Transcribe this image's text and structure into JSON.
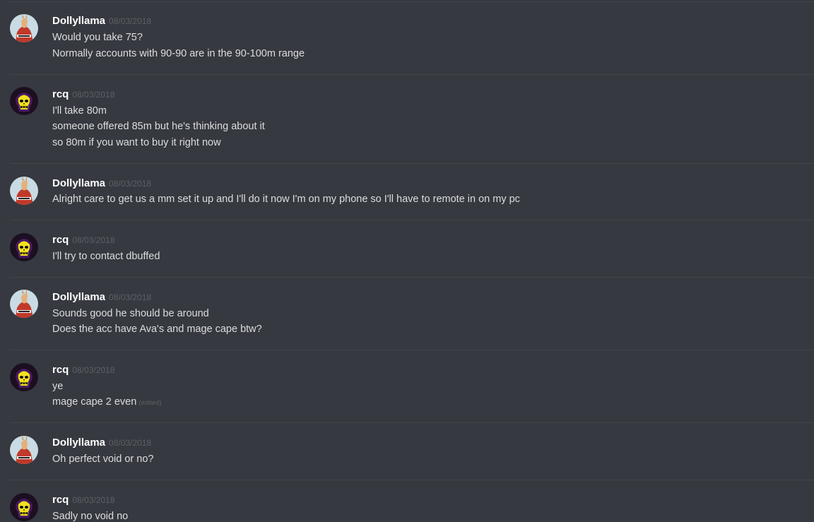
{
  "messages": [
    {
      "author": "Dollyllama",
      "timestamp": "08/03/2018",
      "avatar": "llama-avatar",
      "lines": [
        "Would you take 75?",
        "Normally accounts with 90-90 are in the 90-100m range"
      ]
    },
    {
      "author": "rcq",
      "timestamp": "08/03/2018",
      "avatar": "skull-avatar",
      "lines": [
        "I'll take 80m",
        "someone offered 85m but he's thinking about it",
        "so 80m if you want to buy it right now"
      ]
    },
    {
      "author": "Dollyllama",
      "timestamp": "08/03/2018",
      "avatar": "llama-avatar",
      "lines": [
        "Alright care to get us a mm set it up and I'll do it now I'm on my phone so I'll have to remote in on my pc"
      ]
    },
    {
      "author": "rcq",
      "timestamp": "08/03/2018",
      "avatar": "skull-avatar",
      "lines": [
        "I'll try to contact dbuffed"
      ]
    },
    {
      "author": "Dollyllama",
      "timestamp": "08/03/2018",
      "avatar": "llama-avatar",
      "lines": [
        "Sounds good he should be around",
        "Does the acc have Ava's and mage cape btw?"
      ]
    },
    {
      "author": "rcq",
      "timestamp": "08/03/2018",
      "avatar": "skull-avatar",
      "lines": [
        "ye",
        "mage cape 2 even"
      ],
      "edited_label": "(edited)"
    },
    {
      "author": "Dollyllama",
      "timestamp": "08/03/2018",
      "avatar": "llama-avatar",
      "lines": [
        "Oh perfect void or no?"
      ]
    },
    {
      "author": "rcq",
      "timestamp": "08/03/2018",
      "avatar": "skull-avatar",
      "lines": [
        "Sadly no void no"
      ]
    }
  ],
  "colors": {
    "background": "#36393f",
    "username": "#ffffff",
    "message_text": "#dcddde",
    "timestamp": "#5d6066",
    "divider": "#42454a"
  }
}
